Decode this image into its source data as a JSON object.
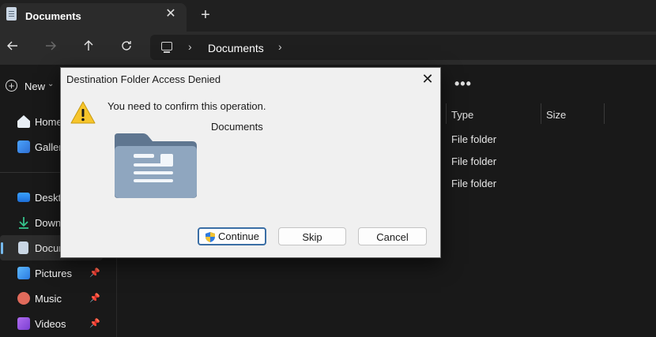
{
  "tab": {
    "title": "Documents",
    "close_glyph": "✕",
    "new_tab_glyph": "+"
  },
  "nav": {
    "back_icon": "arrow-left-icon",
    "forward_icon": "arrow-right-icon",
    "up_icon": "arrow-up-icon",
    "refresh_icon": "refresh-icon",
    "breadcrumb": [
      "Documents"
    ]
  },
  "command_bar": {
    "new_label": "New",
    "more_glyph": "•••"
  },
  "sidebar": {
    "items": [
      {
        "label": "Home",
        "icon": "home-icon"
      },
      {
        "label": "Gallery",
        "icon": "gallery-icon"
      },
      {
        "label": "Desktop",
        "icon": "desktop-icon"
      },
      {
        "label": "Downloads",
        "icon": "downloads-icon"
      },
      {
        "label": "Documents",
        "icon": "documents-icon"
      },
      {
        "label": "Pictures",
        "icon": "pictures-icon"
      },
      {
        "label": "Music",
        "icon": "music-icon"
      },
      {
        "label": "Videos",
        "icon": "videos-icon"
      }
    ],
    "pin_glyph": "📌"
  },
  "file_list": {
    "columns": [
      "Type",
      "Size"
    ],
    "rows": [
      {
        "type": "File folder"
      },
      {
        "type": "File folder"
      },
      {
        "type": "File folder"
      }
    ]
  },
  "dialog": {
    "title": "Destination Folder Access Denied",
    "close_glyph": "✕",
    "message": "You need to confirm this operation.",
    "folder_name": "Documents",
    "buttons": {
      "continue": "Continue",
      "skip": "Skip",
      "cancel": "Cancel"
    }
  },
  "colors": {
    "accent": "#76b9ed",
    "warning": "#f7c52b",
    "dialog_bg": "#f0f0f0",
    "folder": "#8fa6bf"
  }
}
